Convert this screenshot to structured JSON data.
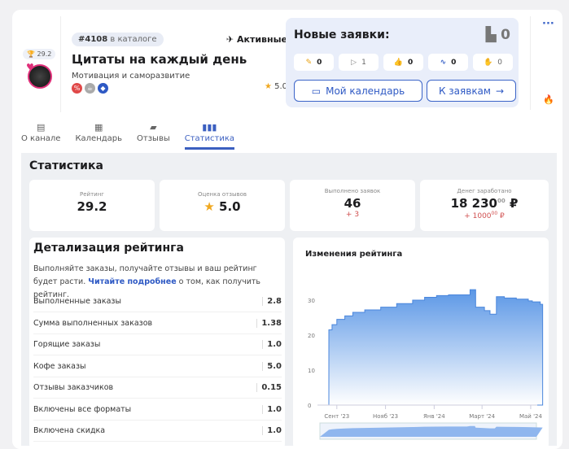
{
  "channel": {
    "rank": "29.2",
    "catalog_num": "#4108",
    "catalog_label": "в каталоге",
    "status": "Активные",
    "title": "Цитаты на каждый день",
    "category": "Мотивация и саморазвитие",
    "rating": "5.0"
  },
  "requests": {
    "title": "Новые заявки:",
    "count": "0",
    "chips": [
      "0",
      "1",
      "0",
      "0",
      "0"
    ],
    "calendar_btn": "Мой календарь",
    "requests_btn": "К заявкам"
  },
  "tabs": [
    "О канале",
    "Календарь",
    "Отзывы",
    "Статистика"
  ],
  "stats": {
    "title": "Статистика",
    "cards": [
      {
        "label": "Рейтинг",
        "value": "29.2",
        "delta": ""
      },
      {
        "label": "Оценка отзывов",
        "value": "5.0",
        "delta": ""
      },
      {
        "label": "Выполнено заявок",
        "value": "46",
        "delta": "+ 3"
      },
      {
        "label": "Денег заработано",
        "value": "18 230",
        "cents": "00",
        "currency": "₽",
        "delta": "+ 1000",
        "delta_cents": "00",
        "delta_currency": "₽"
      }
    ]
  },
  "details": {
    "title": "Детализация рейтинга",
    "text1": "Выполняйте заказы, получайте отзывы и ваш рейтинг будет расти.",
    "link": "Читайте подробнее",
    "text2": "о том, как получить рейтинг.",
    "rows": [
      {
        "label": "Выполненные заказы",
        "value": "2.8"
      },
      {
        "label": "Сумма выполненных заказов",
        "value": "1.38"
      },
      {
        "label": "Горящие заказы",
        "value": "1.0"
      },
      {
        "label": "Кофе заказы",
        "value": "5.0"
      },
      {
        "label": "Отзывы заказчиков",
        "value": "0.15"
      },
      {
        "label": "Включены все форматы",
        "value": "1.0"
      },
      {
        "label": "Включена скидка",
        "value": "1.0"
      }
    ]
  },
  "chart_data": {
    "type": "area",
    "title": "Изменения рейтинга",
    "xlabel": "",
    "ylabel": "",
    "ylim": [
      0,
      35
    ],
    "yticks": [
      0,
      10,
      20,
      30
    ],
    "xticks": [
      {
        "day": 0,
        "label": "Сент '23"
      },
      {
        "day": 61,
        "label": "Нояб '23"
      },
      {
        "day": 122,
        "label": "Янв '24"
      },
      {
        "day": 182,
        "label": "Март '24"
      },
      {
        "day": 243,
        "label": "Май '24"
      }
    ],
    "x_unit": "days since 2023-09-01",
    "color": "#5b97e6",
    "points": [
      [
        -10,
        21.5
      ],
      [
        -6,
        23
      ],
      [
        0,
        24.5
      ],
      [
        10,
        25.5
      ],
      [
        20,
        26.5
      ],
      [
        35,
        27.2
      ],
      [
        55,
        28
      ],
      [
        75,
        29
      ],
      [
        95,
        30
      ],
      [
        110,
        30.8
      ],
      [
        125,
        31.3
      ],
      [
        140,
        31.5
      ],
      [
        163,
        31.5
      ],
      [
        167,
        33
      ],
      [
        173,
        33
      ],
      [
        174,
        28
      ],
      [
        185,
        27
      ],
      [
        192,
        26
      ],
      [
        198,
        26
      ],
      [
        200,
        31
      ],
      [
        210,
        30.6
      ],
      [
        225,
        30.3
      ],
      [
        240,
        29.8
      ],
      [
        245,
        29.5
      ],
      [
        255,
        28.8
      ],
      [
        258,
        28.5
      ]
    ]
  }
}
